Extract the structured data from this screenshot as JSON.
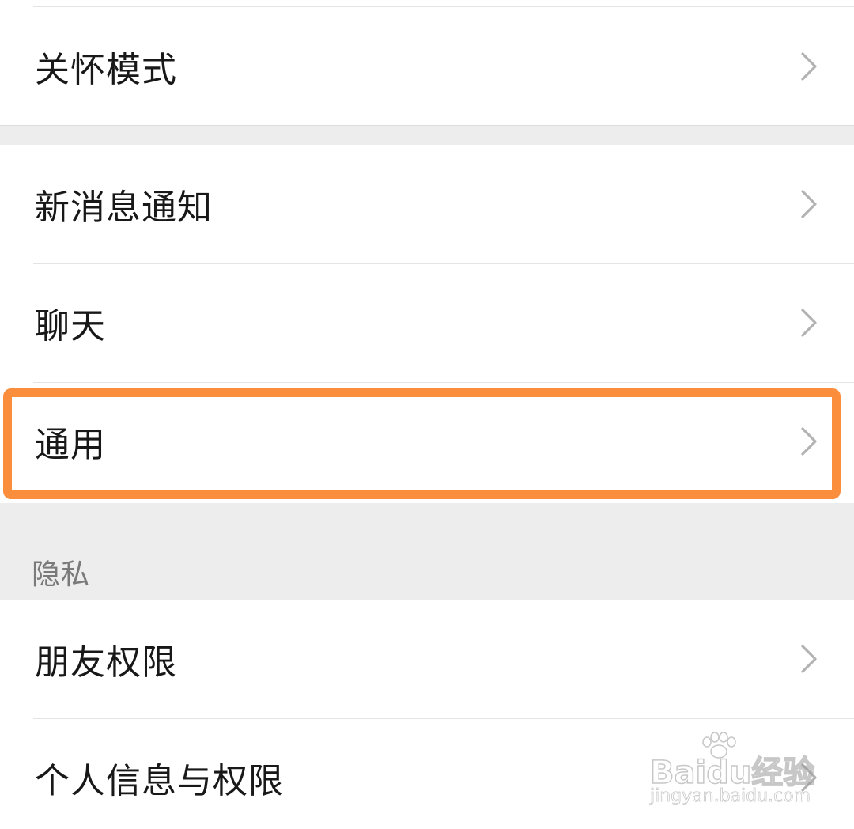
{
  "groups": [
    {
      "items": [
        {
          "label": "关怀模式"
        }
      ]
    },
    {
      "items": [
        {
          "label": "新消息通知"
        },
        {
          "label": "聊天"
        },
        {
          "label": "通用"
        }
      ]
    },
    {
      "section_title": "隐私",
      "items": [
        {
          "label": "朋友权限"
        },
        {
          "label": "个人信息与权限"
        }
      ]
    }
  ],
  "highlight": {
    "target": "通用",
    "color": "#fb8e3c"
  },
  "watermark": {
    "brand": "Baidu经验",
    "url": "jingyan.baidu.com"
  },
  "colors": {
    "background": "#ededed",
    "row": "#ffffff",
    "text": "#181818",
    "secondary_text": "#7a7a7a",
    "chevron": "#b2b2b2"
  },
  "icons": {
    "row_arrow": "chevron-right-icon",
    "watermark_logo": "paw-icon"
  }
}
